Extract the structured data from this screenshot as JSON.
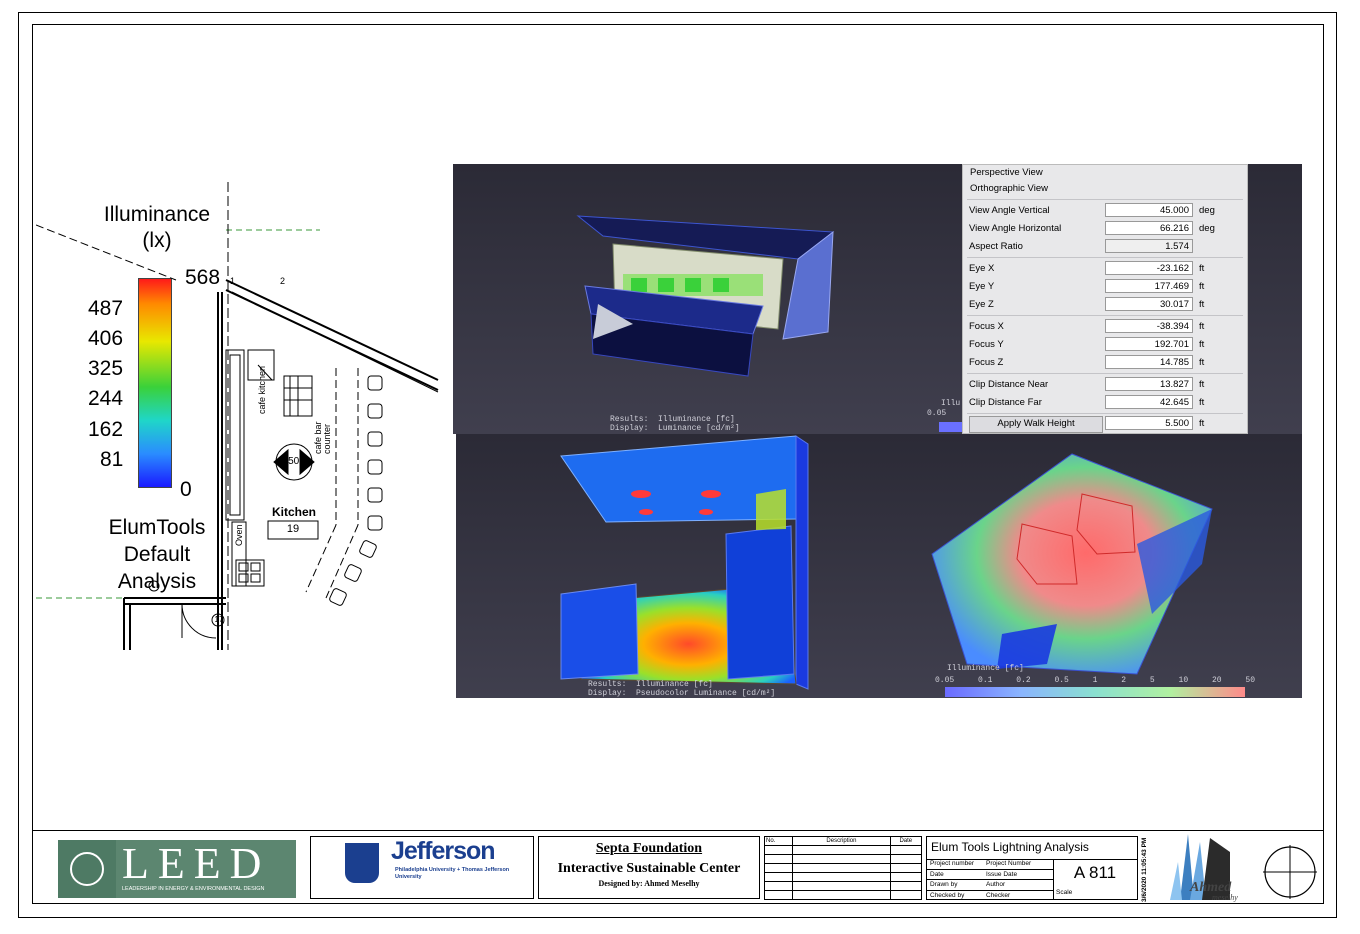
{
  "legend": {
    "title": "Illuminance",
    "unit": "(lx)",
    "max": "568",
    "ticks": [
      "487",
      "406",
      "325",
      "244",
      "162",
      "81"
    ],
    "min": "0",
    "footer": [
      "ElumTools",
      "Default",
      "Analysis"
    ]
  },
  "plan": {
    "room_name": "Kitchen",
    "room_number": "19",
    "section_tag": "A 501",
    "section_left_num": "1",
    "section_right_num": "2",
    "label_cafe_kitchen": "cafe kitchen",
    "label_cafe_bar": "cafe bar counter",
    "label_oven": "Oven",
    "door_tag": "17"
  },
  "renders": {
    "tl_caption": "Results:  Illuminance [fc]\nDisplay:  Luminance [cd/m²]",
    "bl_caption": "Results:  Illuminance [fc]\nDisplay:  Pseudocolor Luminance [cd/m²]",
    "br_scale_title": "Illuminance [fc]",
    "br_scale_ticks": [
      "0.05",
      "0.1",
      "0.2",
      "0.5",
      "1",
      "2",
      "5",
      "10",
      "20",
      "50"
    ],
    "tr_partial_label": "Illu",
    "tr_partial_tick": "0.05"
  },
  "view_props": {
    "modes": [
      "Perspective View",
      "Orthographic View"
    ],
    "rows": [
      {
        "label": "View Angle Vertical",
        "value": "45.000",
        "unit": "deg"
      },
      {
        "label": "View Angle Horizontal",
        "value": "66.216",
        "unit": "deg"
      },
      {
        "label": "Aspect Ratio",
        "value": "1.574",
        "unit": ""
      },
      {
        "label": "Eye X",
        "value": "-23.162",
        "unit": "ft"
      },
      {
        "label": "Eye Y",
        "value": "177.469",
        "unit": "ft"
      },
      {
        "label": "Eye Z",
        "value": "30.017",
        "unit": "ft"
      },
      {
        "label": "Focus X",
        "value": "-38.394",
        "unit": "ft"
      },
      {
        "label": "Focus Y",
        "value": "192.701",
        "unit": "ft"
      },
      {
        "label": "Focus Z",
        "value": "14.785",
        "unit": "ft"
      },
      {
        "label": "Clip Distance Near",
        "value": "13.827",
        "unit": "ft"
      },
      {
        "label": "Clip Distance Far",
        "value": "42.645",
        "unit": "ft"
      }
    ],
    "button": "Apply Walk Height",
    "walk_value": "5.500",
    "walk_unit": "ft"
  },
  "title_block": {
    "leed_word": "LEED",
    "leed_sub": "LEADERSHIP IN ENERGY & ENVIRONMENTAL DESIGN",
    "jefferson_name": "Jefferson",
    "jefferson_sub": "Philadelphia University + Thomas Jefferson University",
    "project_title": "Septa Foundation",
    "project_subtitle": "Interactive Sustainable Center",
    "designer": "Designed by: Ahmed Meselhy",
    "rev_headers": [
      "No.",
      "Description",
      "Date"
    ],
    "sheet_title": "Elum Tools Lightning Analysis",
    "fields": [
      {
        "label": "Project number",
        "value": "Project Number"
      },
      {
        "label": "Date",
        "value": "Issue Date"
      },
      {
        "label": "Drawn by",
        "value": "Author"
      },
      {
        "label": "Checked by",
        "value": "Checker"
      }
    ],
    "sheet_number": "A 811",
    "scale_label": "Scale",
    "timestamp": "3/6/2020 11:05:43 PM",
    "logo_script": "Ahmed",
    "logo_script2": "meselhy"
  },
  "colors": {
    "render_bg": "#34333f",
    "leed_green": "#4e7a64",
    "jefferson_blue": "#1b3f8f"
  }
}
